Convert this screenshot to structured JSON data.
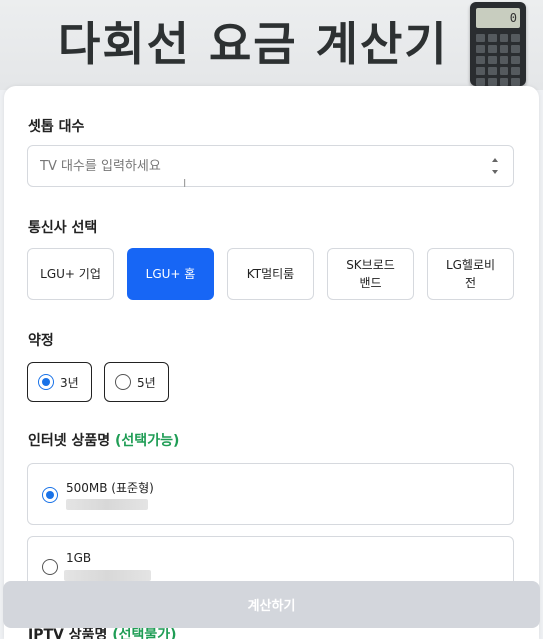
{
  "header": {
    "title": "다회선 요금 계산기",
    "calculator_display": "0"
  },
  "settop": {
    "label": "셋톱 대수",
    "placeholder": "TV 대수를 입력하세요",
    "value": ""
  },
  "carrier": {
    "label": "통신사 선택",
    "options": [
      "LGU+ 기업",
      "LGU+ 홈",
      "KT멀티룸",
      "SK브로드밴드",
      "LG헬로비전"
    ],
    "selected": "LGU+ 홈"
  },
  "contract": {
    "label": "약정",
    "options": [
      "3년",
      "5년"
    ],
    "selected": "3년"
  },
  "internet": {
    "label": "인터넷 상품명",
    "label_note": "(선택가능)",
    "products": [
      "500MB (표준형)",
      "1GB"
    ],
    "selected": "500MB (표준형)"
  },
  "iptv": {
    "label": "IPTV 상품명",
    "label_note": "(선택불가)"
  },
  "actions": {
    "calculate_label": "계산하기"
  },
  "colors": {
    "accent": "#1766f5",
    "note_green": "#1f9d55",
    "disabled_button": "#d3d6dc"
  }
}
